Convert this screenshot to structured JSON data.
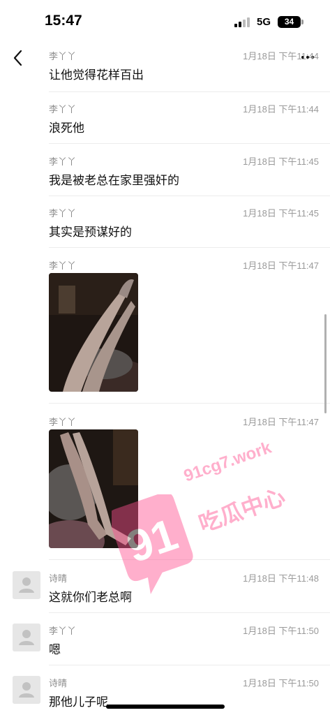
{
  "status_bar": {
    "time": "15:47",
    "network": "5G",
    "battery": "34"
  },
  "nav": {
    "back_icon": "chevron-left-icon",
    "more_icon": "more-dots-icon"
  },
  "messages": [
    {
      "sender": "李丫丫",
      "time": "1月18日 下午11:44",
      "text": "让他觉得花样百出",
      "avatar": "none"
    },
    {
      "sender": "李丫丫",
      "time": "1月18日 下午11:44",
      "text": "浪死他",
      "avatar": "none"
    },
    {
      "sender": "李丫丫",
      "time": "1月18日 下午11:45",
      "text": "我是被老总在家里强奸的",
      "avatar": "none"
    },
    {
      "sender": "李丫丫",
      "time": "1月18日 下午11:45",
      "text": "其实是预谋好的",
      "avatar": "none"
    },
    {
      "sender": "李丫丫",
      "time": "1月18日 下午11:47",
      "text": "",
      "avatar": "none",
      "image": "photo-image"
    },
    {
      "sender": "李丫丫",
      "time": "1月18日 下午11:47",
      "text": "",
      "avatar": "none",
      "image": "photo-image"
    },
    {
      "sender": "诗晴",
      "time": "1月18日 下午11:48",
      "text": "这就你们老总啊",
      "avatar": "default-user-icon"
    },
    {
      "sender": "李丫丫",
      "time": "1月18日 下午11:50",
      "text": "嗯",
      "avatar": "default-user-icon"
    },
    {
      "sender": "诗晴",
      "time": "1月18日 下午11:50",
      "text": "那他儿子呢",
      "avatar": "default-user-icon"
    }
  ],
  "watermark": {
    "number": "91",
    "site": "91cg7.work",
    "name": "吃瓜中心"
  },
  "colors": {
    "background": "#ffffff",
    "meta_text": "#9a9a9a",
    "message_text": "#111111",
    "divider": "#ececec",
    "watermark": "#ff4f8f"
  }
}
